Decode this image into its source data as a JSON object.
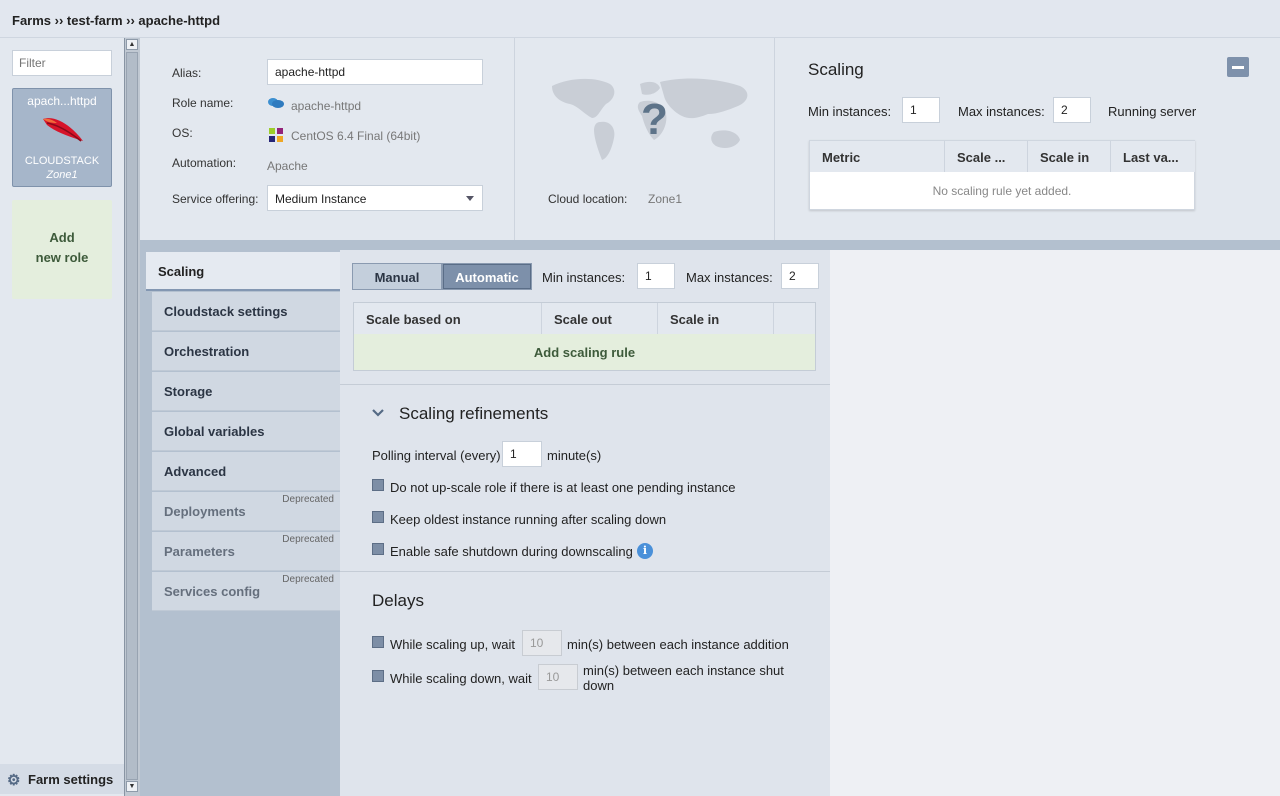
{
  "breadcrumb": "Farms ›› test-farm ›› apache-httpd",
  "sidebar": {
    "filter_placeholder": "Filter",
    "role": {
      "name": "apach...httpd",
      "platform": "CLOUDSTACK",
      "zone": "Zone1"
    },
    "add_role_line1": "Add",
    "add_role_line2": "new role",
    "farm_settings": "Farm settings"
  },
  "info": {
    "alias_label": "Alias:",
    "alias_value": "apache-httpd",
    "role_name_label": "Role name:",
    "role_name_value": "apache-httpd",
    "os_label": "OS:",
    "os_value": "CentOS 6.4 Final (64bit)",
    "automation_label": "Automation:",
    "automation_value": "Apache",
    "service_offering_label": "Service offering:",
    "service_offering_value": "Medium Instance",
    "cloud_location_label": "Cloud location:",
    "cloud_location_value": "Zone1"
  },
  "summary": {
    "title": "Scaling",
    "min_label": "Min instances:",
    "min_value": "1",
    "max_label": "Max instances:",
    "max_value": "2",
    "running_label": "Running servers",
    "columns": [
      "Metric",
      "Scale ...",
      "Scale in",
      "Last va..."
    ],
    "empty": "No scaling rule yet added."
  },
  "nav": [
    {
      "label": "Scaling",
      "tag": ""
    },
    {
      "label": "Cloudstack settings",
      "tag": ""
    },
    {
      "label": "Orchestration",
      "tag": ""
    },
    {
      "label": "Storage",
      "tag": ""
    },
    {
      "label": "Global variables",
      "tag": ""
    },
    {
      "label": "Advanced",
      "tag": ""
    },
    {
      "label": "Deployments",
      "tag": "Deprecated"
    },
    {
      "label": "Parameters",
      "tag": "Deprecated"
    },
    {
      "label": "Services config",
      "tag": "Deprecated"
    }
  ],
  "scaling": {
    "manual": "Manual",
    "automatic": "Automatic",
    "min_label": "Min instances:",
    "min_value": "1",
    "max_label": "Max instances:",
    "max_value": "2",
    "columns": [
      "Scale based on",
      "Scale out",
      "Scale in",
      ""
    ],
    "add_rule": "Add scaling rule",
    "refinements": {
      "title": "Scaling refinements",
      "polling_label": "Polling interval (every)",
      "polling_value": "1",
      "polling_unit": "minute(s)",
      "opt1": "Do not up-scale role if there is at least one pending instance",
      "opt2": "Keep oldest instance running after scaling down",
      "opt3": "Enable safe shutdown during downscaling"
    },
    "delays": {
      "title": "Delays",
      "up_label": "While scaling up, wait",
      "up_value": "10",
      "up_suffix": "min(s) between each instance addition",
      "down_label": "While scaling down, wait",
      "down_value": "10",
      "down_suffix_1": "min(s) between each instance shut",
      "down_suffix_2": "down"
    }
  }
}
